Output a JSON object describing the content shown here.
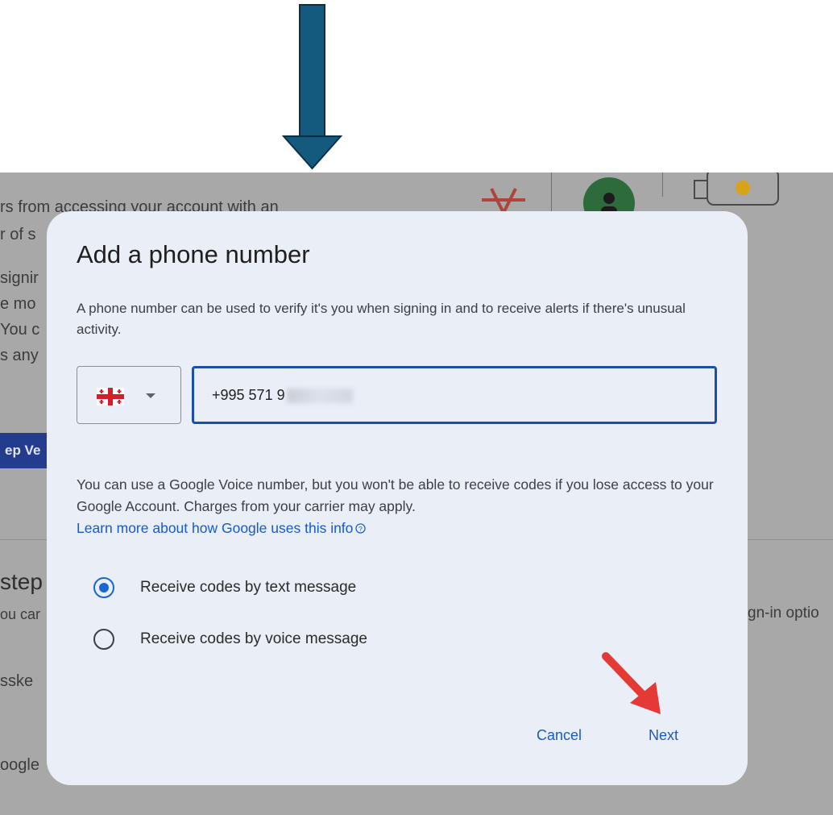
{
  "background": {
    "lines": [
      "rs from accessing your account with an",
      "r of s",
      "signir",
      "e mo",
      "You c",
      "s any"
    ],
    "button_label": "ep Ve",
    "section_heading": "step",
    "line_you": "ou car",
    "line_passkey": "sske",
    "line_google": "oogle",
    "right_text": "gn-in optio"
  },
  "dialog": {
    "title": "Add a phone number",
    "description": "A phone number can be used to verify it's you when signing in and to receive alerts if there's unusual activity.",
    "country_flag": "georgia-flag-icon",
    "phone_value": "+995 571 9",
    "note": "You can use a Google Voice number, but you won't be able to receive codes if you lose access to your Google Account. Charges from your carrier may apply.",
    "learn_more": "Learn more about how Google uses this info",
    "options": [
      {
        "label": "Receive codes by text message",
        "checked": true
      },
      {
        "label": "Receive codes by voice message",
        "checked": false
      }
    ],
    "cancel_label": "Cancel",
    "next_label": "Next"
  },
  "colors": {
    "accent": "#1a59c9",
    "annotation_arrow": "#145a7e",
    "pointer_arrow": "#e53935"
  }
}
